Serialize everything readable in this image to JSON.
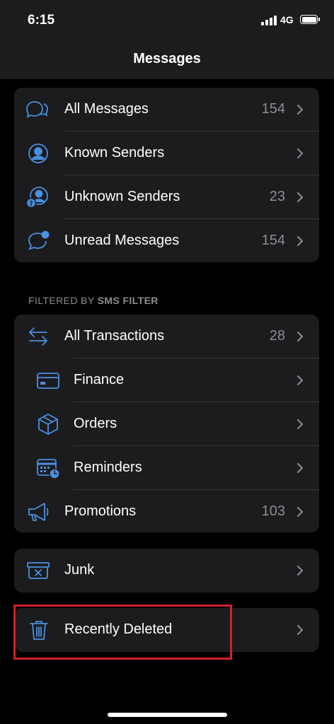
{
  "status_bar": {
    "time": "6:15",
    "network": "4G"
  },
  "nav": {
    "title": "Messages"
  },
  "group1": {
    "items": [
      {
        "label": "All Messages",
        "count": "154",
        "icon": "chat-bubbles-icon"
      },
      {
        "label": "Known Senders",
        "count": "",
        "icon": "person-circle-icon"
      },
      {
        "label": "Unknown Senders",
        "count": "23",
        "icon": "person-question-icon"
      },
      {
        "label": "Unread Messages",
        "count": "154",
        "icon": "chat-unread-icon"
      }
    ]
  },
  "section_header": {
    "prefix": "FILTERED BY ",
    "bold": "SMS FILTER"
  },
  "group2": {
    "items": [
      {
        "label": "All Transactions",
        "count": "28",
        "icon": "arrows-left-right-icon"
      },
      {
        "label": "Finance",
        "count": "",
        "icon": "credit-card-icon"
      },
      {
        "label": "Orders",
        "count": "",
        "icon": "package-box-icon"
      },
      {
        "label": "Reminders",
        "count": "",
        "icon": "calendar-clock-icon"
      },
      {
        "label": "Promotions",
        "count": "103",
        "icon": "megaphone-icon"
      }
    ]
  },
  "group3": {
    "items": [
      {
        "label": "Junk",
        "count": "",
        "icon": "junk-bin-icon"
      }
    ]
  },
  "group4": {
    "items": [
      {
        "label": "Recently Deleted",
        "count": "",
        "icon": "trash-icon"
      }
    ]
  },
  "colors": {
    "accent": "#4a90e2",
    "cell": "#1c1c1e",
    "highlight": "#d21f26",
    "secondary_text": "#8e8e93"
  }
}
